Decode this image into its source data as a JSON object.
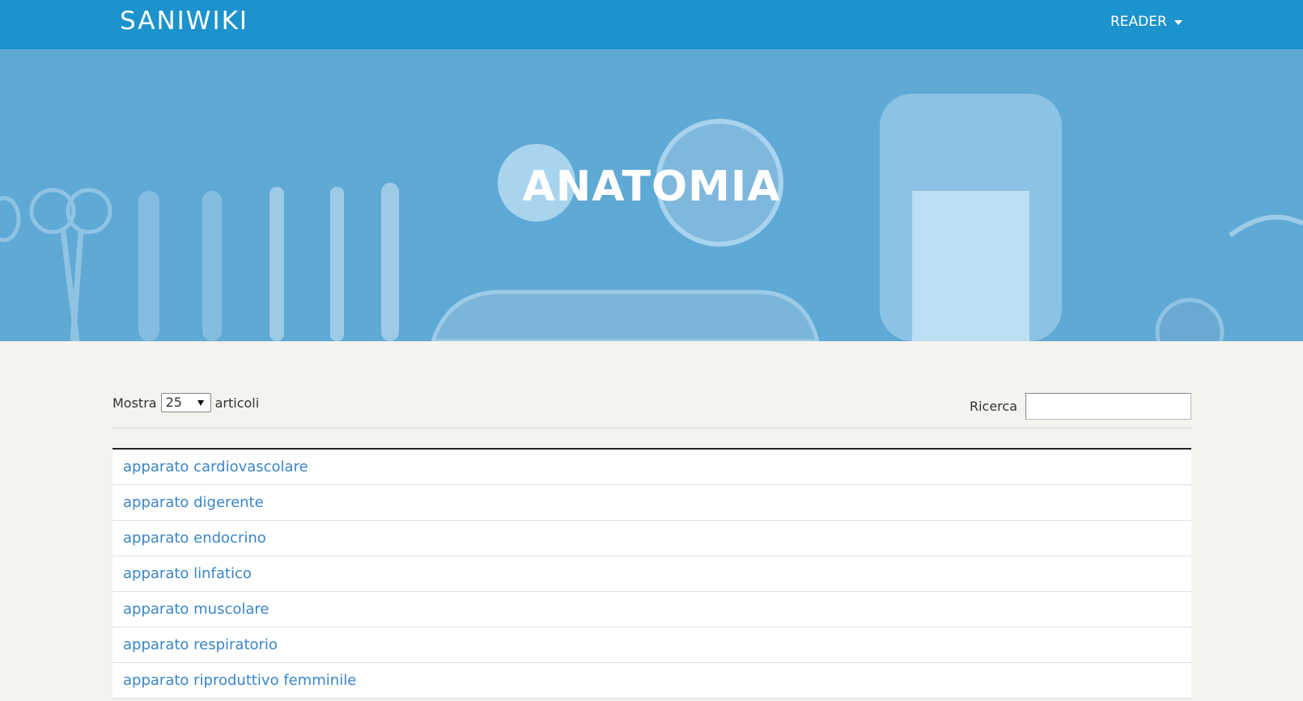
{
  "navbar": {
    "brand": "SANIWIKI",
    "menu_label": "READER"
  },
  "hero": {
    "title": "ANATOMIA"
  },
  "controls": {
    "show_label": "Mostra",
    "page_size": "25",
    "after_label": "articoli",
    "search_label": "Ricerca",
    "search_value": ""
  },
  "articles": [
    "apparato cardiovascolare",
    "apparato digerente",
    "apparato endocrino",
    "apparato linfatico",
    "apparato muscolare",
    "apparato respiratorio",
    "apparato riproduttivo femminile"
  ],
  "colors": {
    "navbar": "#1c93cd",
    "hero": "#5da9d6",
    "link": "#3a86c9",
    "page_bg": "#f4f3ee"
  }
}
